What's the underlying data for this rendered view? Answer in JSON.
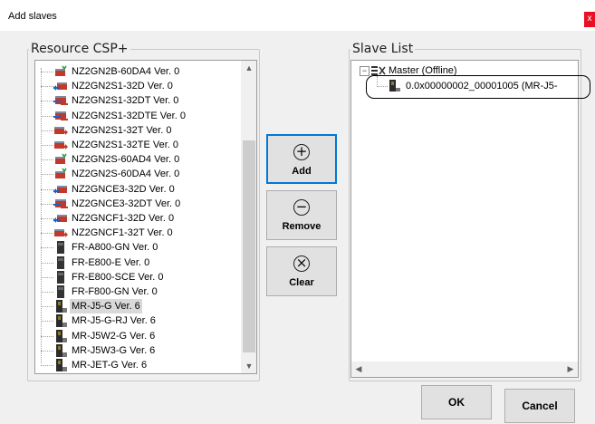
{
  "window": {
    "title": "Add slaves",
    "close_label": "x"
  },
  "resource_panel": {
    "legend": "Resource CSP+",
    "items": [
      {
        "label": "NZ2GN2B-60DA4 Ver. 0",
        "icon": "analog-module-icon"
      },
      {
        "label": "NZ2GN2S1-32D Ver. 0",
        "icon": "input-module-icon"
      },
      {
        "label": "NZ2GN2S1-32DT Ver. 0",
        "icon": "io-module-icon"
      },
      {
        "label": "NZ2GN2S1-32DTE Ver. 0",
        "icon": "io-module-icon"
      },
      {
        "label": "NZ2GN2S1-32T Ver. 0",
        "icon": "output-module-icon"
      },
      {
        "label": "NZ2GN2S1-32TE Ver. 0",
        "icon": "output-module-icon"
      },
      {
        "label": "NZ2GN2S-60AD4 Ver. 0",
        "icon": "analog-module-icon"
      },
      {
        "label": "NZ2GN2S-60DA4 Ver. 0",
        "icon": "analog-module-icon"
      },
      {
        "label": "NZ2GNCE3-32D Ver. 0",
        "icon": "input-module-icon"
      },
      {
        "label": "NZ2GNCE3-32DT Ver. 0",
        "icon": "io-module-icon"
      },
      {
        "label": "NZ2GNCF1-32D Ver. 0",
        "icon": "input-module-icon"
      },
      {
        "label": "NZ2GNCF1-32T Ver. 0",
        "icon": "output-module-icon"
      },
      {
        "label": "FR-A800-GN Ver. 0",
        "icon": "inverter-icon"
      },
      {
        "label": "FR-E800-E Ver. 0",
        "icon": "inverter-icon"
      },
      {
        "label": "FR-E800-SCE Ver. 0",
        "icon": "inverter-icon"
      },
      {
        "label": "FR-F800-GN Ver. 0",
        "icon": "inverter-icon"
      },
      {
        "label": "MR-J5-G Ver. 6",
        "icon": "servo-amplifier-icon"
      },
      {
        "label": "MR-J5-G-RJ Ver. 6",
        "icon": "servo-amplifier-icon"
      },
      {
        "label": "MR-J5W2-G Ver. 6",
        "icon": "servo-amplifier-icon"
      },
      {
        "label": "MR-J5W3-G Ver. 6",
        "icon": "servo-amplifier-icon"
      },
      {
        "label": "MR-JET-G Ver. 6",
        "icon": "servo-amplifier-icon"
      }
    ],
    "selected_index": 16,
    "scroll_up_icon": "scroll-up-arrow-icon",
    "scroll_down_icon": "scroll-down-arrow-icon"
  },
  "buttons": {
    "add": {
      "label": "Add",
      "icon": "plus-circle-icon",
      "glyph": "+"
    },
    "remove": {
      "label": "Remove",
      "icon": "minus-circle-icon",
      "glyph": "−"
    },
    "clear": {
      "label": "Clear",
      "icon": "x-circle-icon",
      "glyph": "×"
    },
    "ok": "OK",
    "cancel": "Cancel"
  },
  "slave_panel": {
    "legend": "Slave List",
    "master_label": "Master (Offline)",
    "master_expand": "−",
    "child_label": "0.0x00000002_00001005 (MR-J5-",
    "scroll_left_icon": "scroll-left-arrow-icon",
    "scroll_right_icon": "scroll-right-arrow-icon"
  },
  "colors": {
    "accent": "#0078d7",
    "close_red": "#e81123",
    "selection": "#d9d9d9"
  }
}
